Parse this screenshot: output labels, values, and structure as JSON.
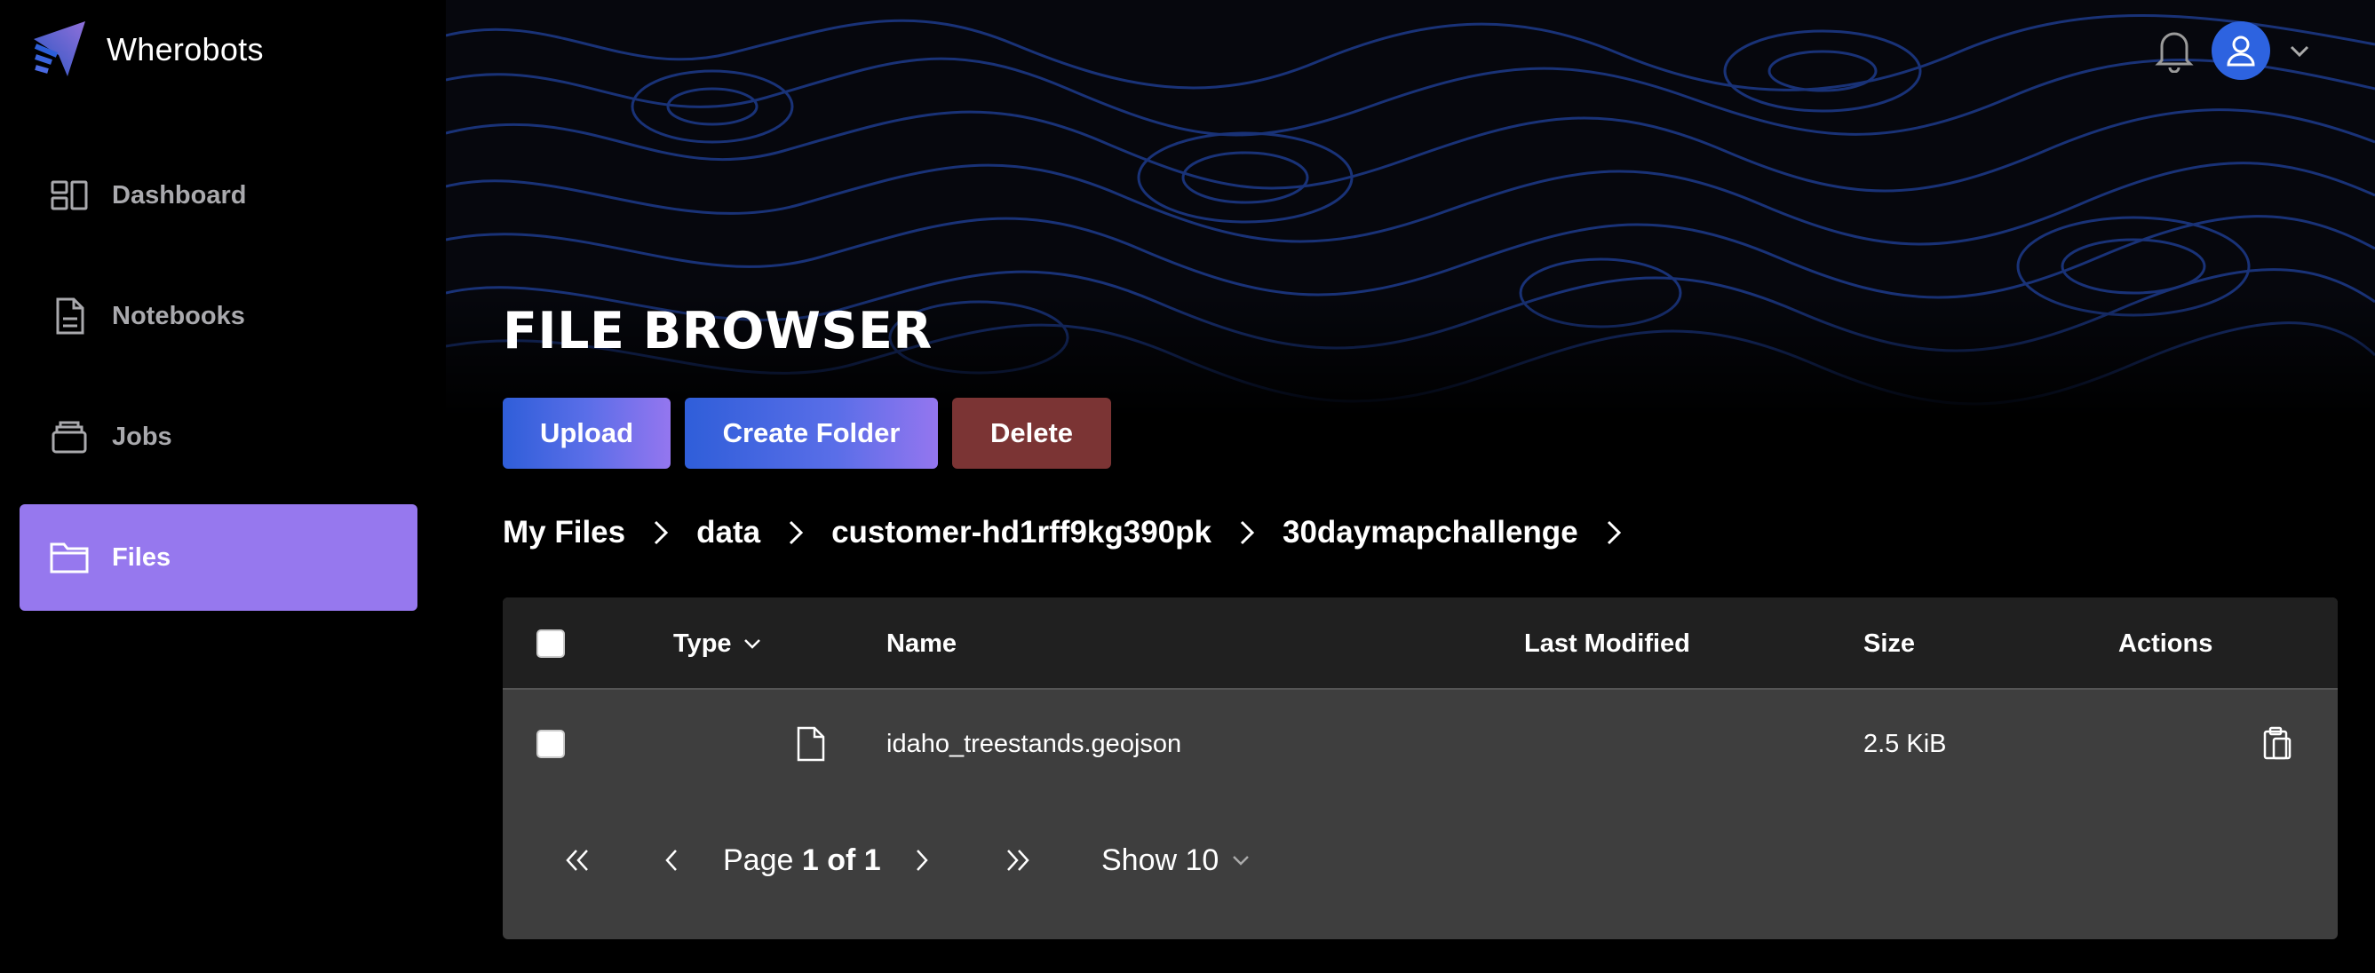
{
  "app": {
    "name": "Wherobots",
    "logo_icon": "wherobots-logo"
  },
  "sidebar": {
    "items": [
      {
        "label": "Dashboard",
        "icon": "dashboard-icon",
        "active": false
      },
      {
        "label": "Notebooks",
        "icon": "notebook-icon",
        "active": false
      },
      {
        "label": "Jobs",
        "icon": "jobs-icon",
        "active": false
      },
      {
        "label": "Files",
        "icon": "folder-icon",
        "active": true
      }
    ]
  },
  "header": {
    "notifications_icon": "bell-icon",
    "user_icon": "user-icon",
    "menu_icon": "chevron-down-icon"
  },
  "page": {
    "title": "FILE BROWSER"
  },
  "toolbar": {
    "upload_label": "Upload",
    "create_folder_label": "Create Folder",
    "delete_label": "Delete"
  },
  "breadcrumb": [
    "My Files",
    "data",
    "customer-hd1rff9kg390pk",
    "30daymapchallenge"
  ],
  "table": {
    "columns": {
      "type": "Type",
      "name": "Name",
      "last_modified": "Last Modified",
      "size": "Size",
      "actions": "Actions"
    },
    "rows": [
      {
        "type_icon": "file-icon",
        "name": "idaho_treestands.geojson",
        "last_modified": "",
        "size": "2.5 KiB",
        "action_icon": "clipboard-icon"
      }
    ]
  },
  "pagination": {
    "page_prefix": "Page ",
    "page_current": "1 of 1",
    "show_label": "Show 10"
  },
  "colors": {
    "accent": "#9678ee",
    "primary_blue": "#2f5ed9",
    "danger": "#7b3434",
    "avatar": "#2d63e0"
  }
}
